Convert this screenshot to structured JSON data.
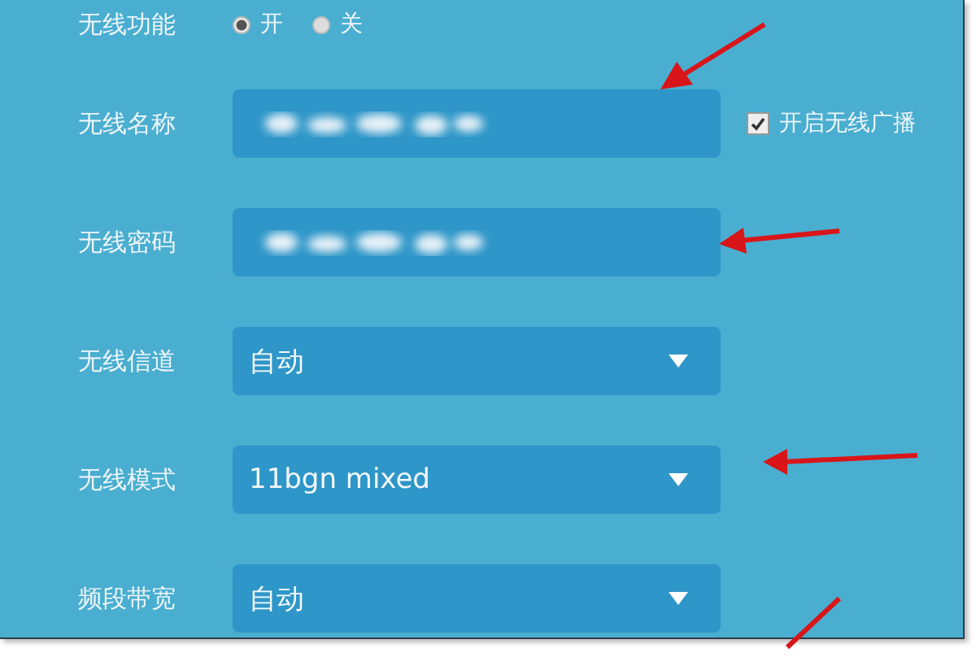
{
  "settings": [
    {
      "kind": "radio",
      "label": "无线功能",
      "options": [
        {
          "label": "开",
          "selected": true
        },
        {
          "label": "关",
          "selected": false
        }
      ]
    },
    {
      "kind": "blurred",
      "label": "无线名称",
      "checkbox": {
        "label": "开启无线广播",
        "checked": true
      }
    },
    {
      "kind": "blurred",
      "label": "无线密码"
    },
    {
      "kind": "select",
      "label": "无线信道",
      "value": "自动"
    },
    {
      "kind": "select",
      "label": "无线模式",
      "value": "11bgn mixed"
    },
    {
      "kind": "select",
      "label": "频段带宽",
      "value": "自动"
    }
  ]
}
